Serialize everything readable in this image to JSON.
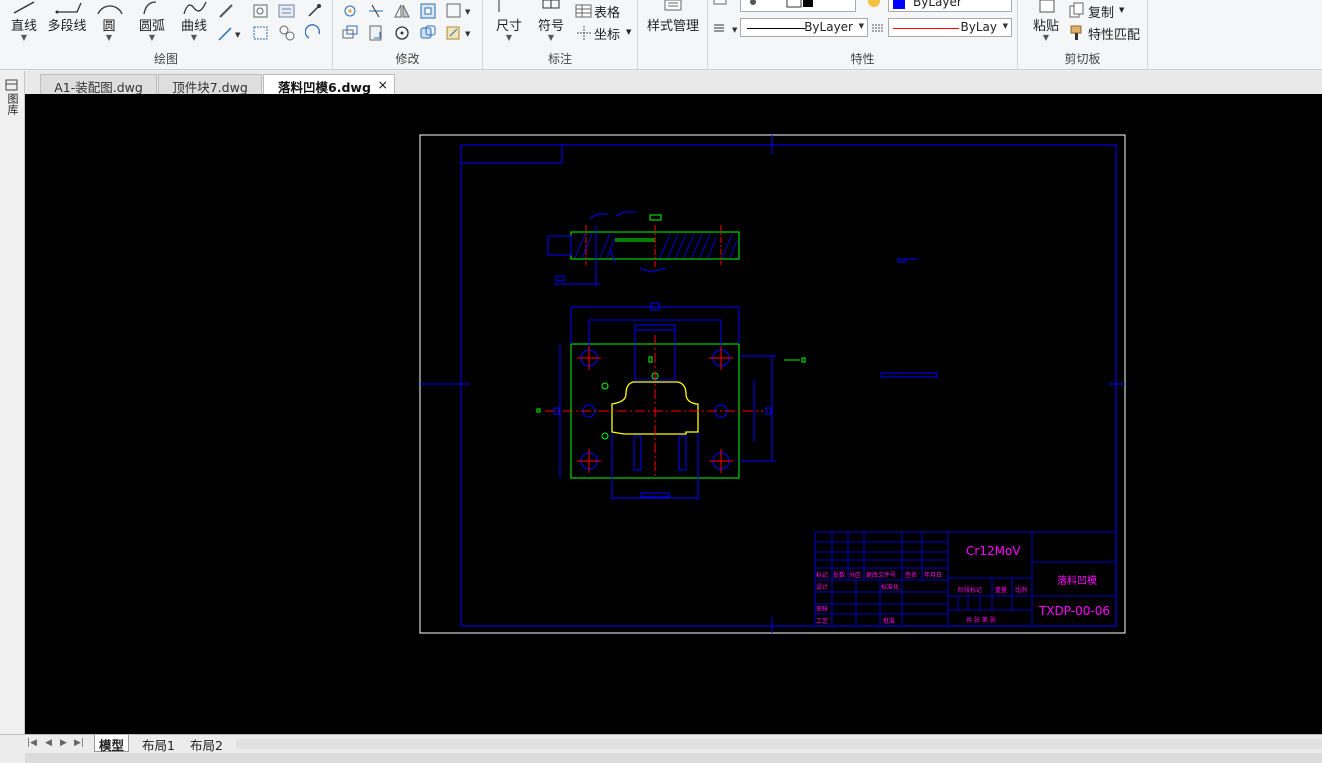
{
  "ribbon": {
    "draw": {
      "label": "绘图",
      "line": "直线",
      "polyline": "多段线",
      "circle": "圆",
      "arc": "圆弧",
      "curve": "曲线"
    },
    "modify": {
      "label": "修改"
    },
    "annotate": {
      "label": "标注",
      "dimension": "尺寸",
      "symbol": "符号",
      "table": "表格",
      "coordinate": "坐标"
    },
    "style": {
      "manage": "样式管理"
    },
    "properties": {
      "label": "特性",
      "linetype_value": "ByLayer",
      "color_value": "ByLay",
      "top_layer_value": "ByLayer"
    },
    "clipboard": {
      "label": "剪切板",
      "paste": "粘贴",
      "copy": "复制",
      "match": "特性匹配"
    }
  },
  "doc_tabs": [
    {
      "label": "A1-装配图.dwg",
      "active": false
    },
    {
      "label": "顶件块7.dwg",
      "active": false
    },
    {
      "label": "落料凹模6.dwg",
      "active": true
    }
  ],
  "close_glyph": "×",
  "left_panel": {
    "label": "图库"
  },
  "drawing": {
    "material": "Cr12MoV",
    "part_name": "落料凹模",
    "drawing_no": "TXDP-00-06",
    "title_cells": {
      "mark": "标记",
      "count": "处数",
      "zone": "分区",
      "change_doc": "更改文件号",
      "sign": "签名",
      "date": "年月日",
      "design": "设计",
      "standard": "标准化",
      "stage": "阶段标记",
      "weight": "重量",
      "scale": "比例",
      "review": "审核",
      "process": "工艺",
      "approve": "批准",
      "sheets": "共 张 第 张"
    }
  },
  "layout_tabs": [
    {
      "label": "模型",
      "active": true
    },
    {
      "label": "布局1",
      "active": false
    },
    {
      "label": "布局2",
      "active": false
    }
  ],
  "nav_arrows": [
    "|◀",
    "◀",
    "▶",
    "▶|"
  ],
  "colors": {
    "canvas_bg": "#000000",
    "border_blue": "#0000ff",
    "frame_white": "#ffffff",
    "part_green": "#00ff00",
    "centerline_red": "#ff0000",
    "title_magenta": "#ff00ff",
    "dim_blue": "#0000ff",
    "highlight_yellow": "#ffff00"
  }
}
